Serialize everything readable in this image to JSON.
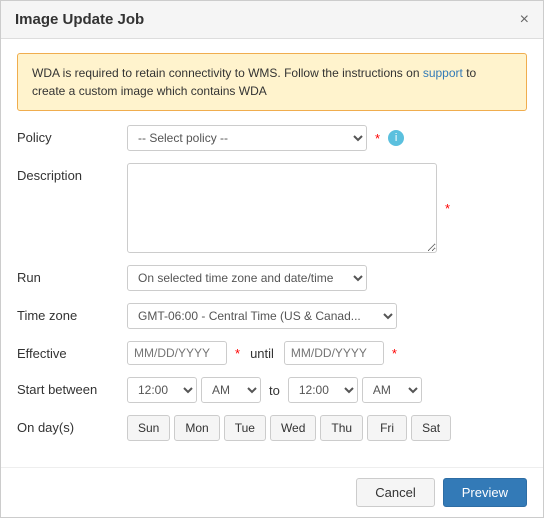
{
  "dialog": {
    "title": "Image Update Job",
    "close_label": "×"
  },
  "alert": {
    "text_before": "WDA is required to retain connectivity to WMS. Follow the instructions on ",
    "link_text": "support",
    "text_after": " to create a custom image which contains WDA"
  },
  "form": {
    "policy_label": "Policy",
    "policy_placeholder": "-- Select policy --",
    "policy_required": "*",
    "description_label": "Description",
    "description_required": "*",
    "run_label": "Run",
    "run_value": "On selected time zone and date/time",
    "timezone_label": "Time zone",
    "timezone_value": "GMT-06:00 - Central Time (US & Canad...",
    "effective_label": "Effective",
    "effective_placeholder": "MM/DD/YYYY",
    "effective_required": "*",
    "until_label": "until",
    "until_placeholder": "MM/DD/YYYY",
    "until_required": "*",
    "start_between_label": "Start between",
    "start_time1": "12:00",
    "ampm1": "AM",
    "to_label": "to",
    "start_time2": "12:00",
    "ampm2": "AM",
    "on_days_label": "On day(s)",
    "days": [
      "Sun",
      "Mon",
      "Tue",
      "Wed",
      "Thu",
      "Fri",
      "Sat"
    ]
  },
  "footer": {
    "cancel_label": "Cancel",
    "preview_label": "Preview"
  }
}
